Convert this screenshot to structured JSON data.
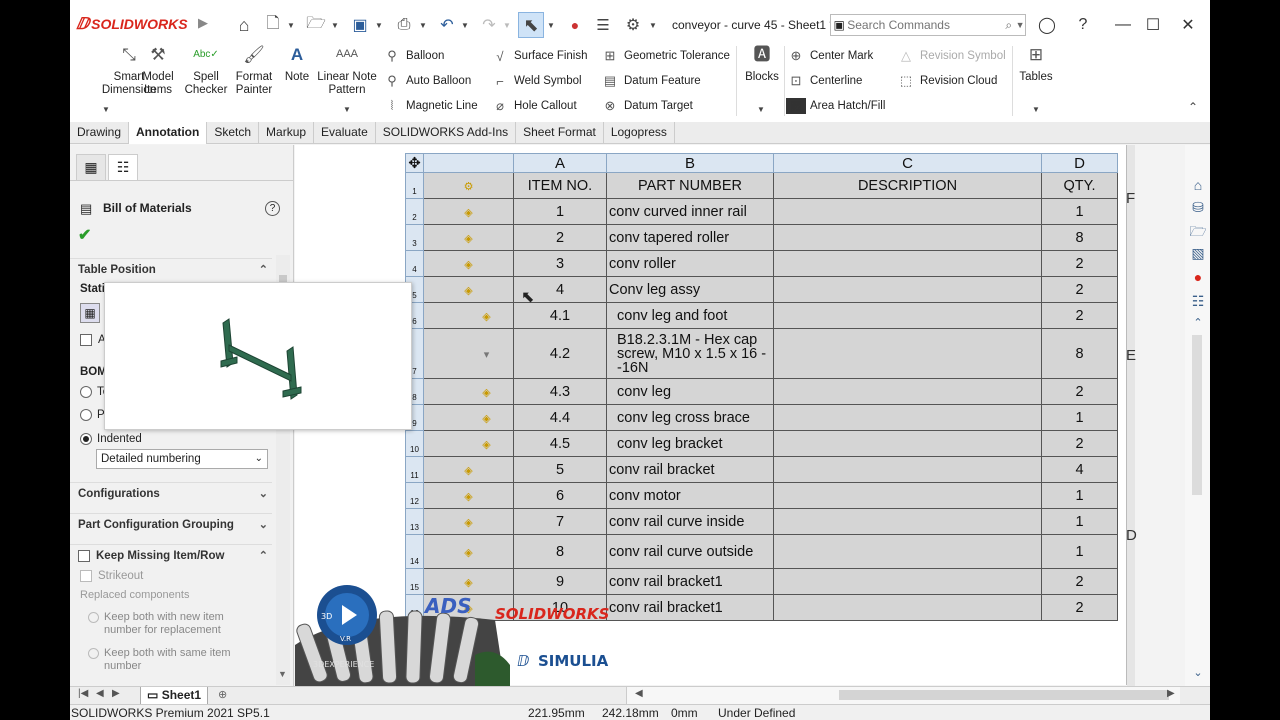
{
  "app": {
    "logo": "SOLIDWORKS",
    "document_title": "conveyor - curve 45 - Sheet1 *"
  },
  "search": {
    "placeholder": "Search Commands"
  },
  "ribbon": {
    "smart_dimension": "Smart Dimension",
    "model_items": "Model Items",
    "spell_checker": "Spell Checker",
    "format_painter": "Format Painter",
    "note": "Note",
    "linear_note_pattern": "Linear Note Pattern",
    "balloon": "Balloon",
    "auto_balloon": "Auto Balloon",
    "magnetic_line": "Magnetic Line",
    "surface_finish": "Surface Finish",
    "weld_symbol": "Weld Symbol",
    "hole_callout": "Hole Callout",
    "geometric_tolerance": "Geometric Tolerance",
    "datum_feature": "Datum Feature",
    "datum_target": "Datum Target",
    "blocks": "Blocks",
    "center_mark": "Center Mark",
    "centerline": "Centerline",
    "area_hatch": "Area Hatch/Fill",
    "revision_symbol": "Revision Symbol",
    "revision_cloud": "Revision Cloud",
    "tables": "Tables"
  },
  "tabs": [
    "Drawing",
    "Annotation",
    "Sketch",
    "Markup",
    "Evaluate",
    "SOLIDWORKS Add-Ins",
    "Sheet Format",
    "Logopress"
  ],
  "active_tab": "Annotation",
  "panel": {
    "title": "Bill of Materials",
    "table_position": "Table Position",
    "static_label": "Stati",
    "bom_label": "BOM",
    "radio_top": "To",
    "radio_parts": "Pa",
    "checkbox_at": "At",
    "indented": "Indented",
    "numbering": "Detailed numbering",
    "configurations": "Configurations",
    "part_config_grouping": "Part Configuration Grouping",
    "keep_missing": "Keep Missing Item/Row",
    "strikeout": "Strikeout",
    "replaced_components": "Replaced components",
    "keep_new": "Keep both with new item number for replacement",
    "keep_same": "Keep both with same item number"
  },
  "bom": {
    "columns": [
      "A",
      "B",
      "C",
      "D"
    ],
    "header": {
      "item": "ITEM NO.",
      "part": "PART NUMBER",
      "desc": "DESCRIPTION",
      "qty": "QTY."
    },
    "rows": [
      {
        "n": "2",
        "item": "1",
        "part": "conv curved inner rail",
        "qty": "1"
      },
      {
        "n": "3",
        "item": "2",
        "part": "conv tapered roller",
        "qty": "8"
      },
      {
        "n": "4",
        "item": "3",
        "part": "conv roller",
        "qty": "2"
      },
      {
        "n": "5",
        "item": "4",
        "part": "Conv leg assy",
        "qty": "2"
      },
      {
        "n": "6",
        "item": "4.1",
        "part": "  conv leg and foot",
        "qty": "2"
      },
      {
        "n": "7",
        "item": "4.2",
        "part": "  B18.2.3.1M - Hex cap screw, M10 x 1.5 x 16 --16N",
        "qty": "8"
      },
      {
        "n": "8",
        "item": "4.3",
        "part": "  conv leg",
        "qty": "2"
      },
      {
        "n": "9",
        "item": "4.4",
        "part": "  conv leg cross brace",
        "qty": "1"
      },
      {
        "n": "10",
        "item": "4.5",
        "part": "  conv leg bracket",
        "qty": "2"
      },
      {
        "n": "11",
        "item": "5",
        "part": "conv rail bracket",
        "qty": "4"
      },
      {
        "n": "12",
        "item": "6",
        "part": "conv motor",
        "qty": "1"
      },
      {
        "n": "13",
        "item": "7",
        "part": "conv rail curve inside",
        "qty": "1"
      },
      {
        "n": "14",
        "item": "8",
        "part": "conv rail curve outside",
        "qty": "1"
      },
      {
        "n": "15",
        "item": "9",
        "part": "conv rail bracket1",
        "qty": "2"
      },
      {
        "n": "16",
        "item": "10",
        "part": "conv rail bracket1",
        "qty": "2"
      }
    ]
  },
  "zones": {
    "f": "F",
    "e": "E",
    "d": "D"
  },
  "watermark": {
    "solidworks": "SOLIDWORKS",
    "simulia": "SIMULIA",
    "ads": "ADS",
    "vr": "V.R",
    "xp": "3DEXPERIENCE"
  },
  "sheet_tab": "Sheet1",
  "status": {
    "product": "SOLIDWORKS Premium 2021 SP5.1",
    "x": "221.95mm",
    "y": "242.18mm",
    "z": "0mm",
    "state": "Under Defined"
  },
  "colors": {
    "brand": "#d9261c",
    "table_header": "#dbe6f2",
    "row_fill": "#d5d5d5",
    "accept": "#2a9d2a"
  }
}
